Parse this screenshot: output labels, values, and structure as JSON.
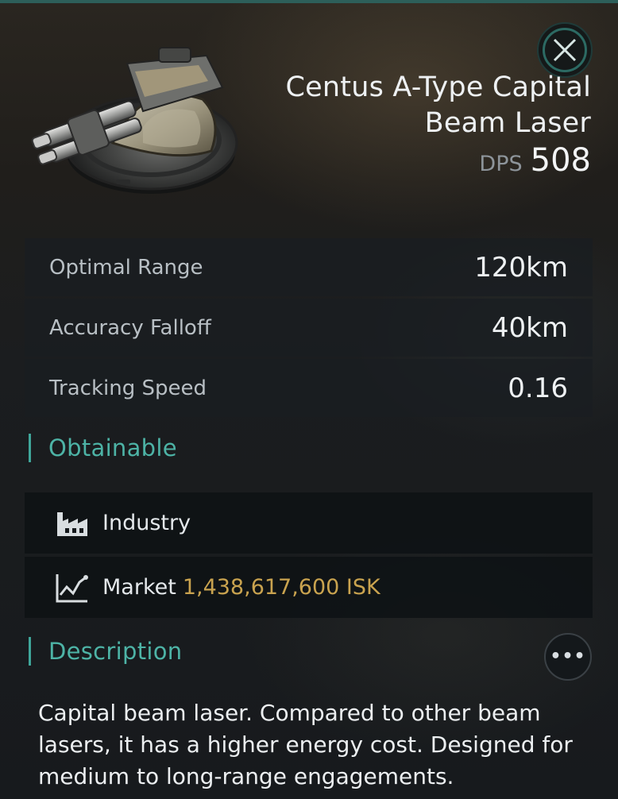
{
  "colors": {
    "accent_teal": "#4db3a6",
    "price_gold": "#c9a34f",
    "panel_bg": "#191e21"
  },
  "header": {
    "item_title": "Centus A-Type Capital Beam Laser",
    "dps_label": "DPS",
    "dps_value": "508",
    "close_icon": "close-x-icon"
  },
  "stats": [
    {
      "label": "Optimal Range",
      "value": "120km"
    },
    {
      "label": "Accuracy Falloff",
      "value": "40km"
    },
    {
      "label": "Tracking Speed",
      "value": "0.16"
    }
  ],
  "obtainable": {
    "section_title": "Obtainable",
    "industry": {
      "icon": "factory-icon",
      "label": "Industry"
    },
    "market": {
      "icon": "line-chart-icon",
      "label": "Market",
      "price": "1,438,617,600 ISK"
    }
  },
  "description": {
    "section_title": "Description",
    "more_icon": "more-options-icon",
    "text": "Capital beam laser. Compared to other beam lasers, it has a higher energy cost. Designed for medium to long-range engagements."
  }
}
